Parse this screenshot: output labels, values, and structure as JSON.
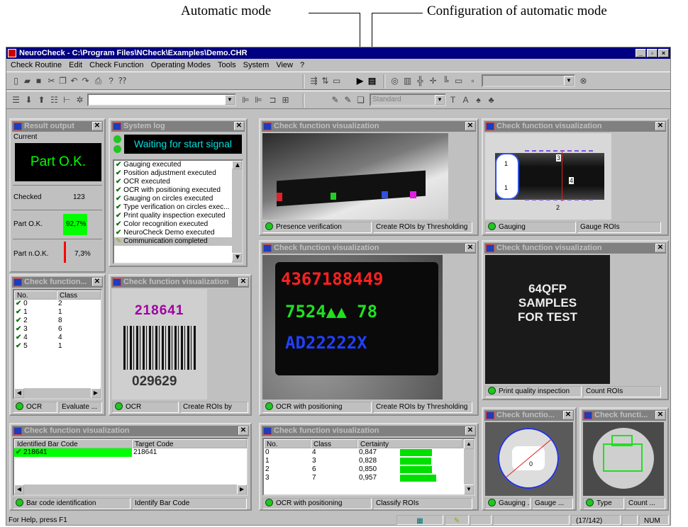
{
  "annotations": {
    "left": "Automatic mode",
    "right": "Configuration of automatic mode"
  },
  "window": {
    "title": "NeuroCheck - C:\\Program Files\\NCheck\\Examples\\Demo.CHR",
    "min": "_",
    "max": "▫",
    "close": "×"
  },
  "menu": [
    "Check Routine",
    "Edit",
    "Check Function",
    "Operating Modes",
    "Tools",
    "System",
    "View",
    "?"
  ],
  "toolbar": {
    "combo_standard": "Standard"
  },
  "result": {
    "title": "Result output",
    "current_label": "Current",
    "big": "Part O.K.",
    "checked_label": "Checked",
    "checked_value": "123",
    "ok_label": "Part O.K.",
    "ok_value": "92,7%",
    "ok_level": 0.927,
    "nok_label": "Part n.O.K.",
    "nok_value": "7,3%",
    "nok_level": 0.073
  },
  "syslog": {
    "title": "System log",
    "status": "Waiting for start signal",
    "items": [
      "Gauging executed",
      "Position adjustment executed",
      "OCR executed",
      "OCR with positioning executed",
      "Gauging on circles executed",
      "Type verification on circles exec...",
      "Print quality inspection executed",
      "Color recognition executed",
      "NeuroCheck Demo executed",
      "Communication completed"
    ]
  },
  "vis_title": "Check function visualization",
  "vis_title_short": "Check function...",
  "vis_title_shorter": "Check functio...",
  "vis_title_tiny": "Check functi...",
  "presence": {
    "left": "Presence verification",
    "right": "Create ROIs by Thresholding"
  },
  "gauging": {
    "left": "Gauging",
    "right": "Gauge ROIs",
    "labels": [
      "1",
      "3",
      "4",
      "2",
      "1"
    ]
  },
  "class_list": {
    "hdr_no": "No.",
    "hdr_class": "Class",
    "rows": [
      [
        "0",
        "2"
      ],
      [
        "1",
        "1"
      ],
      [
        "2",
        "8"
      ],
      [
        "3",
        "6"
      ],
      [
        "4",
        "4"
      ],
      [
        "5",
        "1"
      ]
    ],
    "left": "OCR",
    "right": "Evaluate ..."
  },
  "barcode_img": {
    "top": "218641",
    "bottom": "029629",
    "left": "OCR",
    "right": "Create ROIs by"
  },
  "ocrpos": {
    "line1": "4367188449",
    "line2": "7524▲▲ 78",
    "line3": "AD22222X",
    "left": "OCR with positioning",
    "right": "Create ROIs by Thresholding"
  },
  "print": {
    "line1": "64QFP",
    "line2": "SAMPLES",
    "line3": "FOR TEST",
    "left": "Print quality inspection",
    "right": "Count ROIs"
  },
  "barcode_id": {
    "hdr_a": "Identified Bar Code",
    "hdr_b": "Target Code",
    "val_a": "218641",
    "val_b": "218641",
    "left": "Bar code identification",
    "right": "Identify Bar Code"
  },
  "certainty": {
    "hdr_no": "No.",
    "hdr_class": "Class",
    "hdr_cert": "Certainty",
    "rows": [
      [
        "0",
        "4",
        "0,847"
      ],
      [
        "1",
        "3",
        "0,828"
      ],
      [
        "2",
        "6",
        "0,850"
      ],
      [
        "3",
        "7",
        "0,957"
      ]
    ],
    "left": "OCR with positioning",
    "right": "Classify ROIs"
  },
  "small1": {
    "label": "0",
    "left": "Gauging ...",
    "right": "Gauge ..."
  },
  "small2": {
    "left": "Type",
    "right": "Count ..."
  },
  "status": {
    "help": "For Help, press F1",
    "counter": "(17/142)",
    "num": "NUM"
  },
  "colors": {
    "titlebar": "#000080",
    "ok_green": "#00ff00",
    "nok_red": "#ff0000",
    "led": "#22c522"
  }
}
